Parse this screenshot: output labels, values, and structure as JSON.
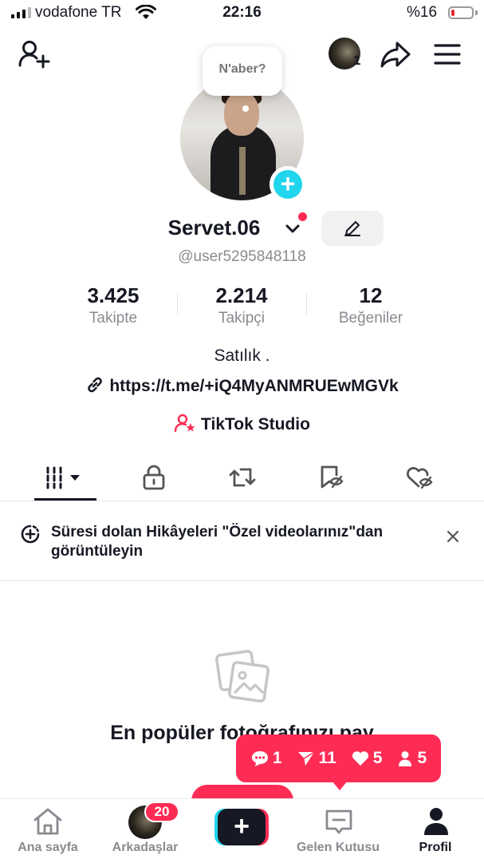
{
  "status_bar": {
    "carrier": "vodafone TR",
    "time": "22:16",
    "battery_pct": "%16",
    "battery_level": 0.16
  },
  "top_bar": {
    "account_count": "1",
    "icons": [
      "add-user-icon",
      "share-icon",
      "menu-icon"
    ]
  },
  "profile": {
    "note_bubble": "N'aber?",
    "display_name": "Servet.06",
    "handle": "@user5295848118",
    "stats": [
      {
        "value": "3.425",
        "label": "Takipte"
      },
      {
        "value": "2.214",
        "label": "Takipçi"
      },
      {
        "value": "12",
        "label": "Beğeniler"
      }
    ],
    "bio": "Satılık .",
    "link": "https://t.me/+iQ4MyANMRUEwMGVk",
    "studio": "TikTok Studio"
  },
  "tabs": [
    "videos-grid-icon",
    "lock-icon",
    "repost-icon",
    "favorites-icon",
    "liked-icon"
  ],
  "banner": {
    "text": "Süresi dolan Hikâyeleri \"Özel videolarınız\"dan görüntüleyin"
  },
  "empty_state": {
    "title": "En popüler fotoğrafınızı pay"
  },
  "notifications": {
    "comments": "1",
    "mentions": "11",
    "likes": "5",
    "followers": "5"
  },
  "bottom_nav": {
    "home": "Ana sayfa",
    "friends": "Arkadaşlar",
    "friends_badge": "20",
    "inbox": "Gelen Kutusu",
    "profile": "Profil"
  },
  "colors": {
    "accent": "#fe2c55",
    "cyan": "#20d5ec",
    "text": "#161823",
    "muted": "#8a8b91"
  }
}
